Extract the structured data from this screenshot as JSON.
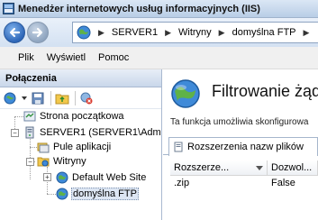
{
  "window": {
    "title": "Menedżer internetowych usług informacyjnych (IIS)"
  },
  "address": {
    "crumbs": [
      "SERVER1",
      "Witryny",
      "domyślna FTP"
    ]
  },
  "menu": {
    "items": [
      "Plik",
      "Wyświetl",
      "Pomoc"
    ]
  },
  "connections": {
    "header": "Połączenia",
    "tree": {
      "start_page": "Strona początkowa",
      "server": "SERVER1 (SERVER1\\Adm",
      "app_pools": "Pule aplikacji",
      "sites": "Witryny",
      "default_site": "Default Web Site",
      "ftp_site": "domyślna FTP"
    }
  },
  "feature": {
    "title": "Filtrowanie żąda",
    "description": "Ta funkcja umożliwia skonfigurowa",
    "tab_label": "Rozszerzenia nazw plików",
    "columns": [
      "Rozszerze...",
      "Dozwol..."
    ],
    "rows": [
      {
        "extension": ".zip",
        "allowed": "False"
      }
    ]
  },
  "icons": {
    "back": "back-arrow-icon",
    "forward": "forward-arrow-icon",
    "globe": "globe-icon"
  },
  "colors": {
    "accent": "#2d66b8",
    "selection": "#dde6f3"
  }
}
